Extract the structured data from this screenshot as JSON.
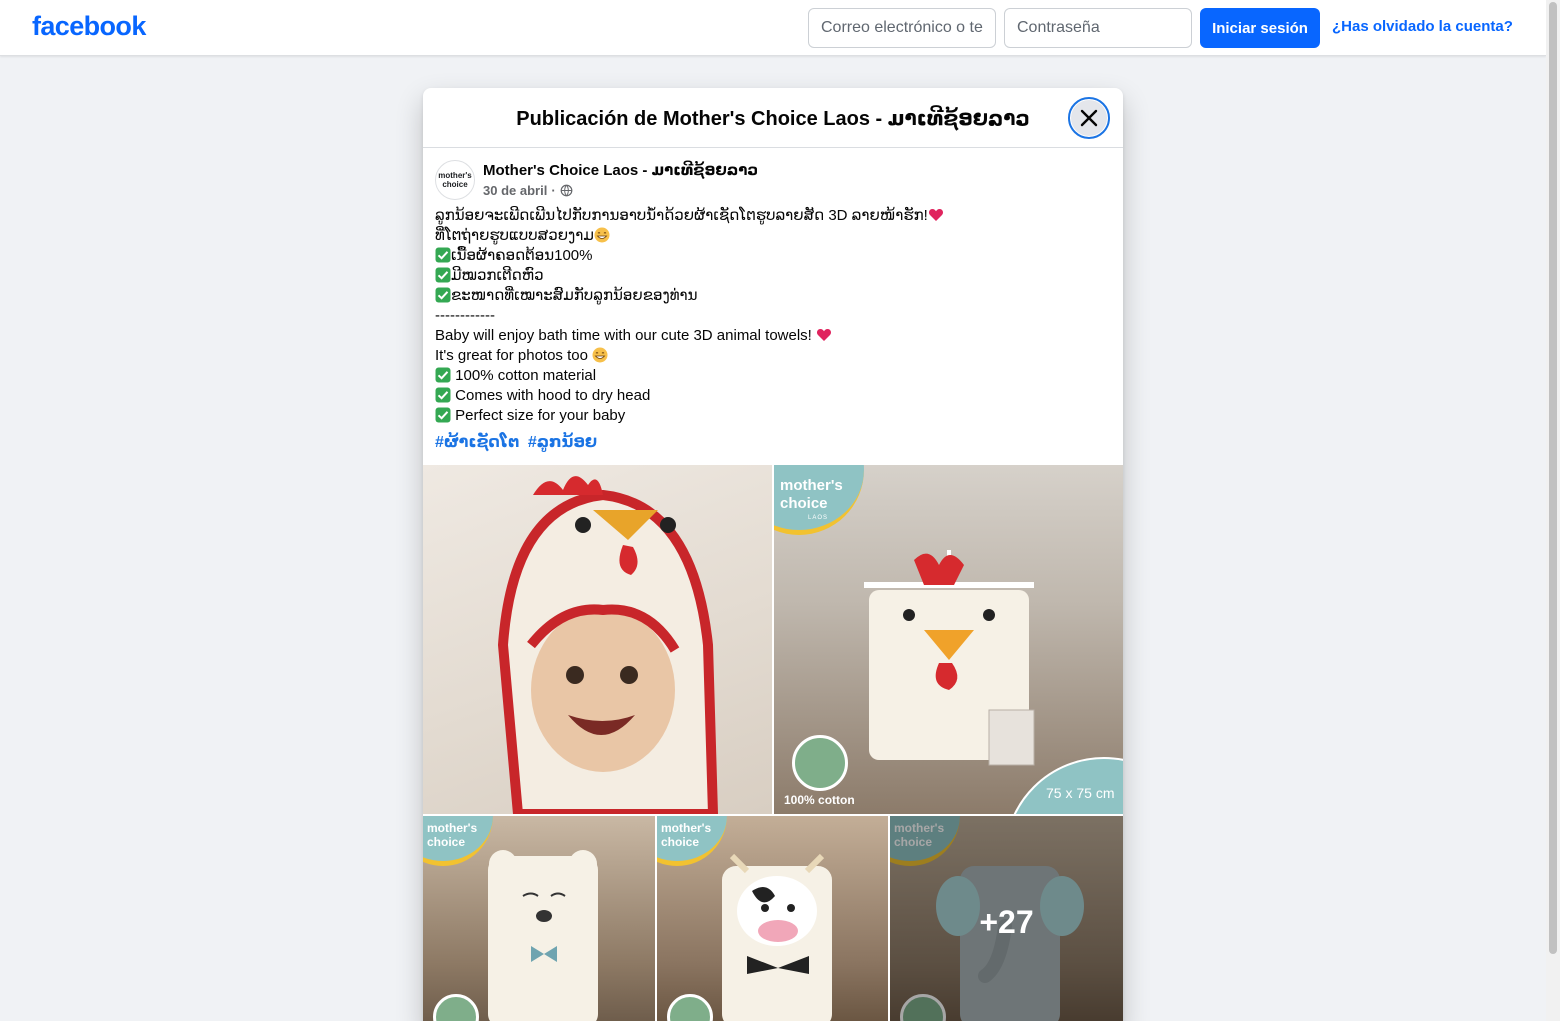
{
  "topbar": {
    "logo": "facebook",
    "email_placeholder": "Correo electrónico o teléfono",
    "password_placeholder": "Contraseña",
    "login_label": "Iniciar sesión",
    "forgot_label": "¿Has olvidado la cuenta?"
  },
  "modal": {
    "title": "Publicación de Mother's Choice Laos - ມາເທີຊ້ອຍລາວ",
    "close_icon": "close-icon"
  },
  "post": {
    "avatar_text": "mother's choice",
    "author": "Mother's Choice Laos - ມາເທີຊ້ອຍລາວ",
    "date": "30 de abril",
    "separator": "·",
    "privacy_icon": "globe-icon",
    "lines": [
      "ລູກນ້ອຍຈະເພີດເພີນໄປກັບການອາບນ້ຳດ້ວຍຜ້າເຊັດໂຕຮູບລາຍສັດ 3D ລາຍໜ້າຮັກ!",
      "ທີ່ໂຕຖ່າຍຮູບແບບສວຍງາມ",
      "ເນື້ອຜ້າຄອດຕ້ອນ100%",
      "ມີໝວກເຕີດຫົວ",
      "ຂະໜາດທີ່ເໝາະສົມກັບລູກນ້ອຍຂອງທ່ານ",
      "------------",
      "Baby will enjoy bath time with our cute 3D animal towels!",
      "It's great for photos too",
      "100% cotton material",
      "Comes with hood to dry head",
      "Perfect size for your baby"
    ],
    "hashtags": [
      "#ຜ້າເຊັດໂຕ",
      "#ລູກນ້ອຍ"
    ]
  },
  "photos": {
    "brand_name": "mother's choice",
    "brand_sub": "LAOS",
    "cotton_label": "100% cotton",
    "size_label": "75 x 75 cm",
    "more_count": "+27"
  },
  "colors": {
    "brand_blue": "#0866ff",
    "link_blue": "#1b74e4",
    "page_bg": "#f0f2f5",
    "check_green": "#34a853",
    "heart_red": "#e0245e",
    "badge_teal": "#8fc3c4"
  }
}
